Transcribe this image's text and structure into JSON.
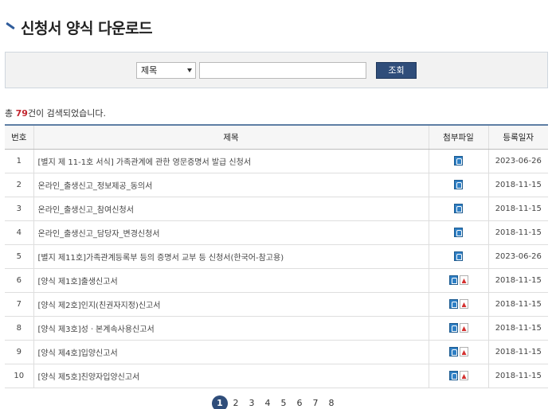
{
  "header": {
    "title": "신청서 양식 다운로드"
  },
  "search": {
    "select_value": "제목",
    "input_value": "",
    "button_label": "조회"
  },
  "summary": {
    "prefix": "총 ",
    "count": "79",
    "suffix": "건이 검색되었습니다."
  },
  "table": {
    "headers": {
      "no": "번호",
      "title": "제목",
      "file": "첨부파일",
      "date": "등록일자"
    },
    "rows": [
      {
        "no": "1",
        "title": "[별지 제 11-1호 서식] 가족관계에 관한 영문증명서 발급 신청서",
        "files": [
          "doc"
        ],
        "date": "2023-06-26"
      },
      {
        "no": "2",
        "title": "온라인_출생신고_정보제공_동의서",
        "files": [
          "doc"
        ],
        "date": "2018-11-15"
      },
      {
        "no": "3",
        "title": "온라인_출생신고_참여신청서",
        "files": [
          "doc"
        ],
        "date": "2018-11-15"
      },
      {
        "no": "4",
        "title": "온라인_출생신고_담당자_변경신청서",
        "files": [
          "doc"
        ],
        "date": "2018-11-15"
      },
      {
        "no": "5",
        "title": "[별지 제11호]가족관계등록부 등의 증명서 교부 등 신청서(한국어-참고용)",
        "files": [
          "doc"
        ],
        "date": "2023-06-26"
      },
      {
        "no": "6",
        "title": "[양식 제1호]출생신고서",
        "files": [
          "doc",
          "pdf"
        ],
        "date": "2018-11-15"
      },
      {
        "no": "7",
        "title": "[양식 제2호]인지(친권자지정)신고서",
        "files": [
          "doc",
          "pdf"
        ],
        "date": "2018-11-15"
      },
      {
        "no": "8",
        "title": "[양식 제3호]성ㆍ본계속사용신고서",
        "files": [
          "doc",
          "pdf"
        ],
        "date": "2018-11-15"
      },
      {
        "no": "9",
        "title": "[양식 제4호]입양신고서",
        "files": [
          "doc",
          "pdf"
        ],
        "date": "2018-11-15"
      },
      {
        "no": "10",
        "title": "[양식 제5호]친양자입양신고서",
        "files": [
          "doc",
          "pdf"
        ],
        "date": "2018-11-15"
      }
    ]
  },
  "pagination": {
    "pages": [
      "1",
      "2",
      "3",
      "4",
      "5",
      "6",
      "7",
      "8"
    ],
    "current": "1"
  },
  "icons": {
    "doc": "hwp-document-icon",
    "pdf": "pdf-document-icon"
  },
  "colors": {
    "accent": "#2f4d7a",
    "count": "#c2262f",
    "header_border": "#5e7ea4"
  }
}
